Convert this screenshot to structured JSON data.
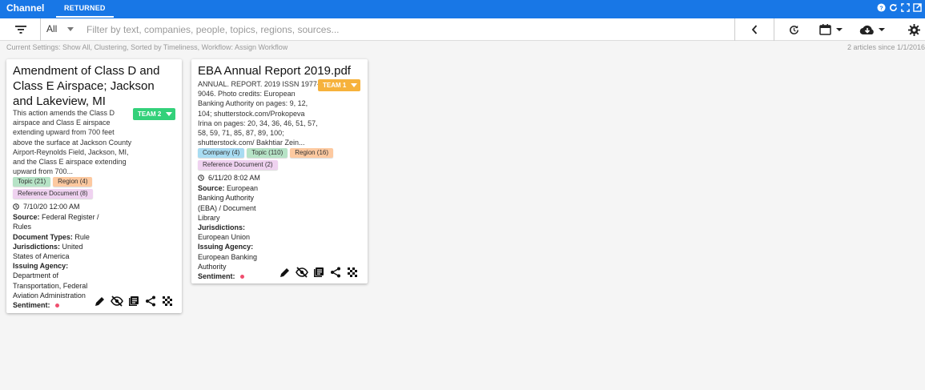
{
  "app": {
    "title": "Channel",
    "active_tab": "RETURNED"
  },
  "toolbar": {
    "scope_value": "All",
    "search_placeholder": "Filter by text, companies, people, topics, regions, sources..."
  },
  "status": {
    "settings_text": "Current Settings: Show All, Clustering, Sorted by Timeliness, Workflow: Assign Workflow",
    "count_text": "2 articles since 1/1/2016"
  },
  "colors": {
    "header_blue": "#1877e6",
    "team2": "#33d17a",
    "team1": "#f6b23c",
    "chip_topic": "#b6e3c6",
    "chip_region": "#fdc9a0",
    "chip_refdoc": "#efd2f0",
    "chip_company": "#a8dcf2",
    "sentiment_negative": "#ef4e6e"
  },
  "cards": [
    {
      "title": "Amendment of Class D and Class E Airspace; Jackson and Lakeview, MI",
      "team_label": "TEAM 2",
      "summary": "This action amends the Class D airspace and Class E airspace extending upward from 700 feet above the surface at Jackson County Airport-Reynolds Field, Jackson, MI, and the Class E airspace extending upward from 700...",
      "chips": [
        {
          "label": "Topic (21)",
          "kind": "topic"
        },
        {
          "label": "Region (4)",
          "kind": "region"
        },
        {
          "label": "Reference Document (8)",
          "kind": "refdoc"
        }
      ],
      "date": "7/10/20 12:00 AM",
      "fields": [
        {
          "label": "Source:",
          "value": "Federal Register / Rules"
        },
        {
          "label": "Document Types:",
          "value": "Rule"
        },
        {
          "label": "Jurisdictions:",
          "value": "United States of America"
        },
        {
          "label": "Issuing Agency:",
          "value": "Department of Transportation, Federal Aviation Administration"
        },
        {
          "label": "Sentiment:",
          "value": ""
        }
      ]
    },
    {
      "title": "EBA Annual Report 2019.pdf",
      "team_label": "TEAM 1",
      "summary": "ANNUAL. REPORT. 2019 ISSN 1977-9046. Photo credits: European Banking Authority on pages: 9, 12, 104; shutterstock.com/Prokopeva Irina on pages: 20, 34, 36, 46, 51, 57, 58, 59, 71, 85, 87, 89, 100; shutterstock.com/ Bakhtiar Zein...",
      "chips": [
        {
          "label": "Company (4)",
          "kind": "company"
        },
        {
          "label": "Topic (110)",
          "kind": "topic"
        },
        {
          "label": "Region (16)",
          "kind": "region"
        },
        {
          "label": "Reference Document (2)",
          "kind": "refdoc"
        }
      ],
      "date": "6/11/20 8:02 AM",
      "fields": [
        {
          "label": "Source:",
          "value": "European Banking Authority (EBA) / Document Library"
        },
        {
          "label": "Jurisdictions:",
          "value": "European Union"
        },
        {
          "label": "Issuing Agency:",
          "value": "European Banking Authority"
        },
        {
          "label": "Sentiment:",
          "value": ""
        }
      ]
    }
  ]
}
